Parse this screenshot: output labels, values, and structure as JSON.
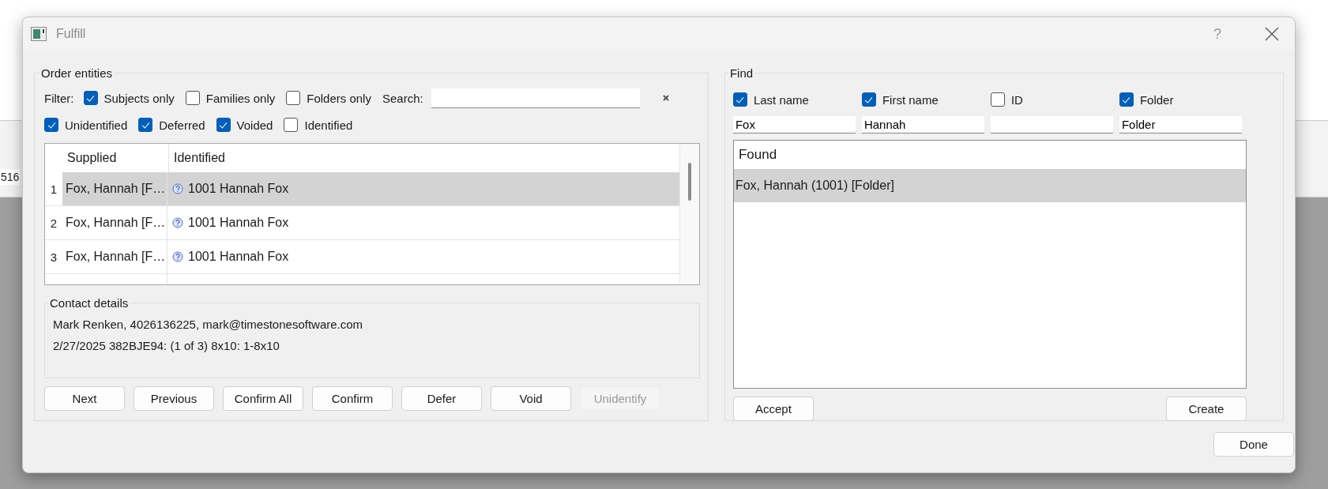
{
  "background_app": {
    "cell_text": "516"
  },
  "window": {
    "title": "Fulfill",
    "help": "?"
  },
  "order_entities": {
    "title": "Order entities",
    "filter_label": "Filter:",
    "filters": [
      {
        "label": "Subjects only",
        "checked": true
      },
      {
        "label": "Families only",
        "checked": false
      },
      {
        "label": "Folders only",
        "checked": false
      }
    ],
    "search_label": "Search:",
    "status_filters": [
      {
        "label": "Unidentified",
        "checked": true
      },
      {
        "label": "Deferred",
        "checked": true
      },
      {
        "label": "Voided",
        "checked": true
      },
      {
        "label": "Identified",
        "checked": false
      }
    ],
    "table": {
      "columns": [
        "Supplied",
        "Identified"
      ],
      "rows": [
        {
          "number": "1",
          "supplied": "Fox, Hannah [F…",
          "identified": "1001 Hannah Fox",
          "selected": true
        },
        {
          "number": "2",
          "supplied": "Fox, Hannah [F…",
          "identified": "1001 Hannah Fox",
          "selected": false
        },
        {
          "number": "3",
          "supplied": "Fox, Hannah [F…",
          "identified": "1001 Hannah Fox",
          "selected": false
        }
      ]
    },
    "contact_details": {
      "title": "Contact details",
      "lines": [
        "Mark Renken, 4026136225, mark@timestonesoftware.com",
        "2/27/2025 382BJE94: (1 of 3) 8x10: 1-8x10"
      ]
    },
    "buttons": [
      {
        "label": "Next",
        "disabled": false
      },
      {
        "label": "Previous",
        "disabled": false
      },
      {
        "label": "Confirm All",
        "disabled": false
      },
      {
        "label": "Confirm",
        "disabled": false
      },
      {
        "label": "Defer",
        "disabled": false
      },
      {
        "label": "Void",
        "disabled": false
      },
      {
        "label": "Unidentify",
        "disabled": true
      }
    ]
  },
  "find": {
    "title": "Find",
    "fields": [
      {
        "label": "Last name",
        "checked": true,
        "value": "Fox"
      },
      {
        "label": "First name",
        "checked": true,
        "value": "Hannah"
      },
      {
        "label": "ID",
        "checked": false
      },
      {
        "label": "Folder",
        "checked": true,
        "value": "Folder"
      }
    ],
    "found": {
      "header": "Found",
      "items": [
        {
          "label": "Fox, Hannah (1001) [Folder]",
          "selected": true
        }
      ]
    },
    "buttons": [
      {
        "label": "Accept"
      },
      {
        "label": "Create"
      }
    ]
  },
  "done_button": "Done"
}
